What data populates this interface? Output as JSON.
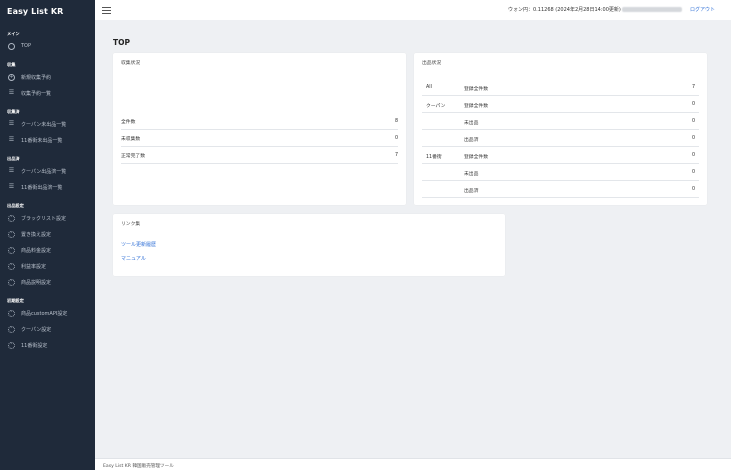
{
  "sidebar": {
    "brand": "Easy List KR",
    "sections": [
      {
        "title": "メイン",
        "items": [
          {
            "label": "TOP",
            "icon": "circle-icon"
          }
        ]
      },
      {
        "title": "収集",
        "items": [
          {
            "label": "新規収集予約",
            "icon": "plus-circle-icon"
          },
          {
            "label": "収集予約一覧",
            "icon": "list-icon"
          }
        ]
      },
      {
        "title": "収集済",
        "items": [
          {
            "label": "クーパン未出品一覧",
            "icon": "list-icon"
          },
          {
            "label": "11番街未出品一覧",
            "icon": "list-icon"
          }
        ]
      },
      {
        "title": "出品済",
        "items": [
          {
            "label": "クーパン出品済一覧",
            "icon": "list-icon"
          },
          {
            "label": "11番街出品済一覧",
            "icon": "list-icon"
          }
        ]
      },
      {
        "title": "出品設定",
        "items": [
          {
            "label": "ブラックリスト設定",
            "icon": "gear-icon"
          },
          {
            "label": "置き換え設定",
            "icon": "gear-icon"
          },
          {
            "label": "商品料金設定",
            "icon": "gear-icon"
          },
          {
            "label": "利益率設定",
            "icon": "gear-icon"
          },
          {
            "label": "商品説明設定",
            "icon": "gear-icon"
          }
        ]
      },
      {
        "title": "初期設定",
        "items": [
          {
            "label": "商品customAPI設定",
            "icon": "gear-icon"
          },
          {
            "label": "クーパン設定",
            "icon": "gear-icon"
          },
          {
            "label": "11番街設定",
            "icon": "gear-icon"
          }
        ]
      }
    ]
  },
  "header": {
    "rate_text": "ウォン円：0.11268 (2024年2月28日14:00更新)",
    "logout": "ログアウト"
  },
  "main": {
    "title": "TOP",
    "collect_status": {
      "title": "収集状況",
      "rows": [
        {
          "label": "全件数",
          "value": "8"
        },
        {
          "label": "未収集数",
          "value": "0"
        },
        {
          "label": "正常完了数",
          "value": "7"
        }
      ]
    },
    "listing_status": {
      "title": "出品状況",
      "rows": [
        {
          "group": "All",
          "label": "登録全件数",
          "value": "7"
        },
        {
          "group": "クーパン",
          "label": "登録全件数",
          "value": "0"
        },
        {
          "group": "",
          "label": "未出品",
          "value": "0"
        },
        {
          "group": "",
          "label": "出品済",
          "value": "0"
        },
        {
          "group": "11番街",
          "label": "登録全件数",
          "value": "0"
        },
        {
          "group": "",
          "label": "未出品",
          "value": "0"
        },
        {
          "group": "",
          "label": "出品済",
          "value": "0"
        }
      ]
    },
    "links": {
      "title": "リンク集",
      "items": [
        "ツール更新履歴",
        "マニュアル"
      ]
    }
  },
  "footer": {
    "text": "Easy List KR 韓国販売管理ツール"
  }
}
